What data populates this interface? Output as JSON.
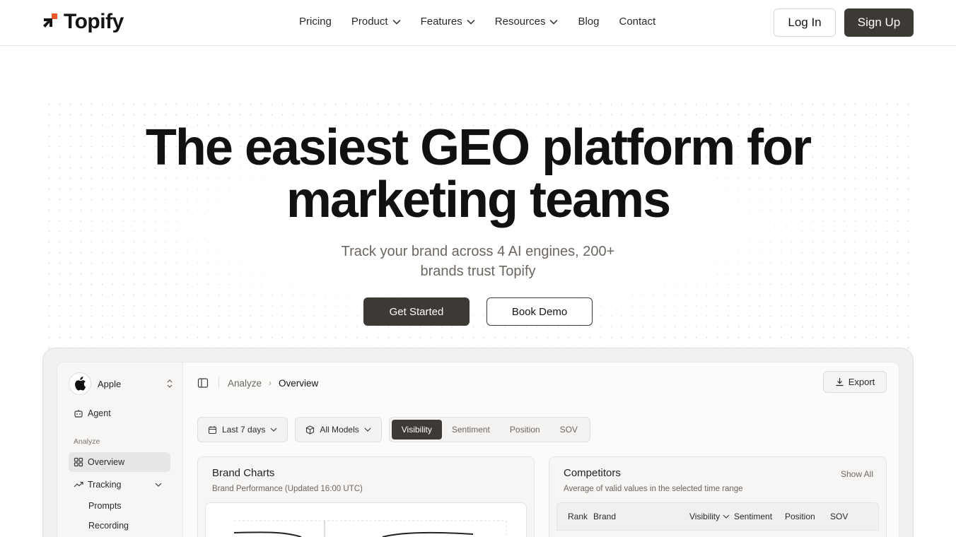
{
  "brand": {
    "name": "Topify",
    "accent": "#f0582a",
    "dark": "#3d3935"
  },
  "nav": {
    "items": [
      {
        "label": "Pricing",
        "dropdown": false
      },
      {
        "label": "Product",
        "dropdown": true
      },
      {
        "label": "Features",
        "dropdown": true
      },
      {
        "label": "Resources",
        "dropdown": true
      },
      {
        "label": "Blog",
        "dropdown": false
      },
      {
        "label": "Contact",
        "dropdown": false
      }
    ],
    "login": "Log In",
    "signup": "Sign Up"
  },
  "hero": {
    "title_line1": "The easiest GEO platform for",
    "title_line2": "marketing teams",
    "subtitle": "Track your brand across 4 AI engines, 200+ brands trust Topify",
    "cta_primary": "Get Started",
    "cta_secondary": "Book Demo"
  },
  "app": {
    "brand_name": "Apple",
    "sidebar": {
      "agent": "Agent",
      "section_label": "Analyze",
      "overview": "Overview",
      "tracking": "Tracking",
      "sub_items": [
        "Prompts",
        "Recording"
      ]
    },
    "breadcrumb": {
      "parent": "Analyze",
      "current": "Overview"
    },
    "export": "Export",
    "filters": {
      "date": "Last 7 days",
      "models": "All Models"
    },
    "metric_tabs": [
      "Visibility",
      "Sentiment",
      "Position",
      "SOV"
    ],
    "active_metric": "Visibility",
    "brand_charts": {
      "title": "Brand Charts",
      "subtitle": "Brand Performance (Updated 16:00 UTC)"
    },
    "competitors": {
      "title": "Competitors",
      "show_all": "Show All",
      "subtitle": "Average of valid values in the selected time range",
      "columns": [
        "Rank",
        "Brand",
        "Visibility",
        "Sentiment",
        "Position",
        "SOV"
      ]
    }
  }
}
